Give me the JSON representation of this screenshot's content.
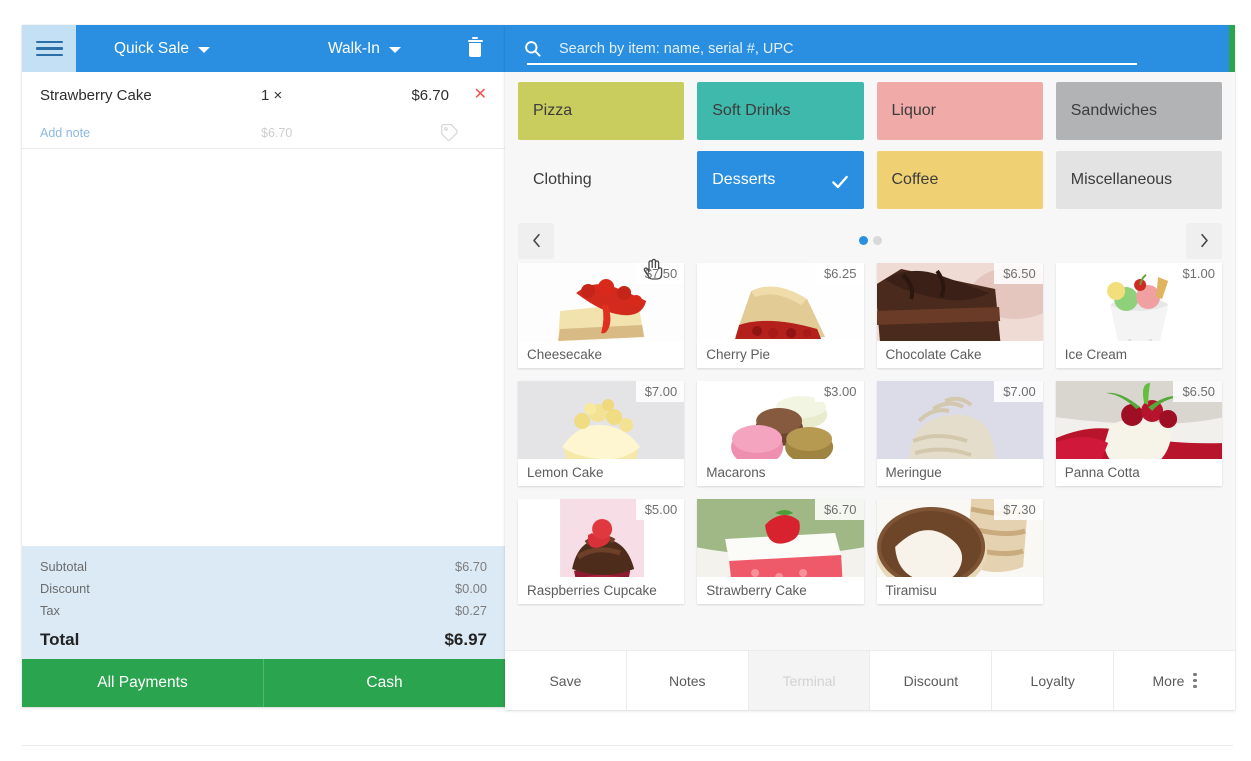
{
  "cart": {
    "menu_icon": "hamburger-icon",
    "sale_type": "Quick Sale",
    "customer": "Walk-In",
    "delete_icon": "trash-icon",
    "items": [
      {
        "name": "Strawberry Cake",
        "qty": "1 ×",
        "price": "$6.70",
        "remove": "✕",
        "note_label": "Add note",
        "unit_price": "$6.70",
        "tag_icon": "tag-icon"
      }
    ],
    "totals": [
      {
        "label": "Subtotal",
        "value": "$6.70"
      },
      {
        "label": "Discount",
        "value": "$0.00"
      },
      {
        "label": "Tax",
        "value": "$0.27"
      }
    ],
    "total_label": "Total",
    "total_value": "$6.97",
    "payment_buttons": [
      {
        "label": "All Payments"
      },
      {
        "label": "Cash"
      }
    ]
  },
  "search": {
    "icon": "search-icon",
    "placeholder": "Search by item: name, serial #, UPC",
    "value": ""
  },
  "categories": [
    {
      "label": "Pizza",
      "color": "#c9cd5e",
      "selected": false
    },
    {
      "label": "Soft Drinks",
      "color": "#3fb9ac",
      "selected": false
    },
    {
      "label": "Liquor",
      "color": "#f0aaa8",
      "selected": false
    },
    {
      "label": "Sandwiches",
      "color": "#b1b3b5",
      "selected": false
    },
    {
      "label": "Clothing",
      "color": "#f5a košt",
      "selected": false
    },
    {
      "label": "Desserts",
      "color": "#2a8fe0",
      "selected": true
    },
    {
      "label": "Coffee",
      "color": "#efd173",
      "selected": false
    },
    {
      "label": "Miscellaneous",
      "color": "#e3e3e3",
      "selected": false
    }
  ],
  "carousel": {
    "prev_icon": "chevron-left-icon",
    "next_icon": "chevron-right-icon",
    "pages": 2,
    "active_page": 1
  },
  "products": [
    {
      "name": "Cheesecake",
      "price": "$7.50",
      "image": "cheesecake-photo"
    },
    {
      "name": "Cherry Pie",
      "price": "$6.25",
      "image": "cherry-pie-photo"
    },
    {
      "name": "Chocolate Cake",
      "price": "$6.50",
      "image": "chocolate-cake-photo"
    },
    {
      "name": "Ice Cream",
      "price": "$1.00",
      "image": "ice-cream-photo"
    },
    {
      "name": "Lemon Cake",
      "price": "$7.00",
      "image": "lemon-cake-photo"
    },
    {
      "name": "Macarons",
      "price": "$3.00",
      "image": "macarons-photo"
    },
    {
      "name": "Meringue",
      "price": "$7.00",
      "image": "meringue-photo"
    },
    {
      "name": "Panna Cotta",
      "price": "$6.50",
      "image": "panna-cotta-photo"
    },
    {
      "name": "Raspberries Cupcake",
      "price": "$5.00",
      "image": "raspberries-cupcake-photo"
    },
    {
      "name": "Strawberry Cake",
      "price": "$6.70",
      "image": "strawberry-cake-photo"
    },
    {
      "name": "Tiramisu",
      "price": "$7.30",
      "image": "tiramisu-photo"
    }
  ],
  "toolbar": [
    {
      "label": "Save",
      "disabled": false
    },
    {
      "label": "Notes",
      "disabled": false
    },
    {
      "label": "Terminal",
      "disabled": true
    },
    {
      "label": "Discount",
      "disabled": false
    },
    {
      "label": "Loyalty",
      "disabled": false
    },
    {
      "label": "More",
      "disabled": false,
      "icon": "kebab-icon"
    }
  ],
  "colors": {
    "header_blue": "#2a8fe0",
    "pay_green": "#2aa44f",
    "totals_bg": "#dceaf6",
    "remove_red": "#ef5350"
  }
}
